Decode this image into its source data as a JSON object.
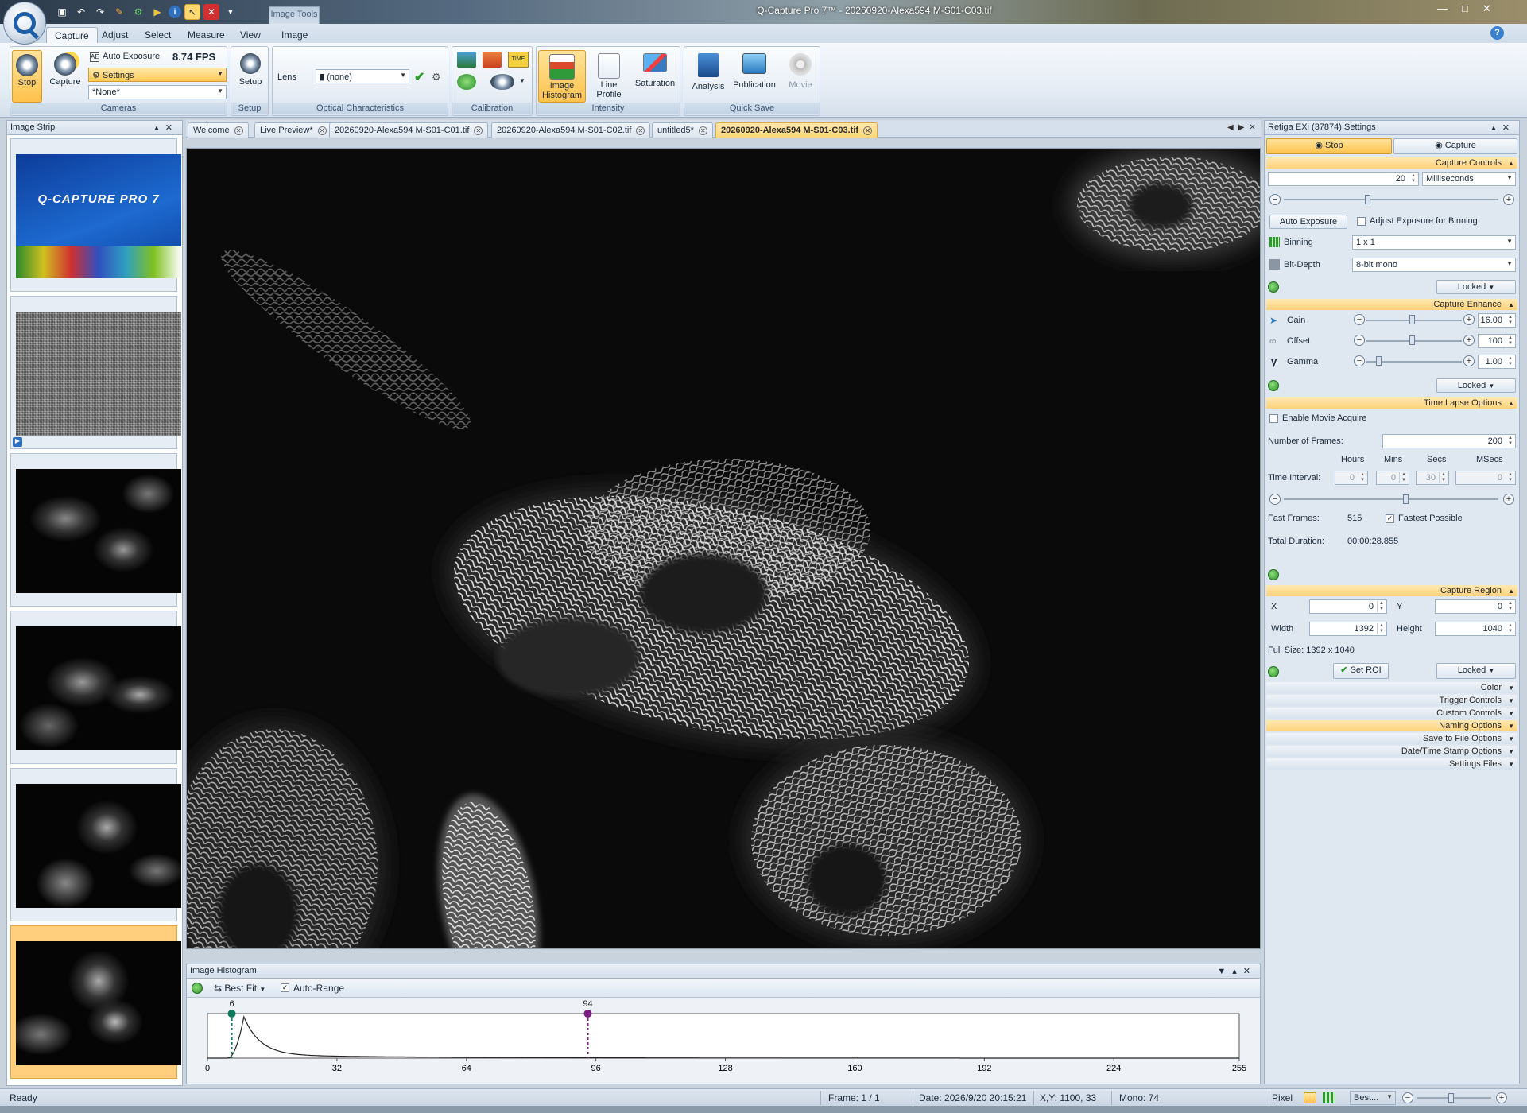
{
  "window": {
    "title": "Q-Capture Pro 7™ - 20260920-Alexa594 M-S01-C03.tif",
    "tool_tab": "Image Tools"
  },
  "ribbon": {
    "tabs": [
      "Capture",
      "Adjust",
      "Select",
      "Measure",
      "View",
      "Image"
    ],
    "stop_label": "Stop",
    "capture_label": "Capture",
    "auto_exposure": "Auto Exposure",
    "fps": "8.74 FPS",
    "settings_label": "Settings",
    "preset": "*None*",
    "group_cameras": "Cameras",
    "setup_label": "Setup",
    "group_setup": "Setup",
    "lens_label": "Lens",
    "lens_value": "(none)",
    "group_optical": "Optical Characteristics",
    "group_calibration": "Calibration",
    "image_histogram": "Image Histogram",
    "line_profile": "Line Profile",
    "saturation": "Saturation",
    "group_intensity": "Intensity",
    "analysis": "Analysis",
    "publication": "Publication",
    "movie": "Movie",
    "group_quicksave": "Quick Save"
  },
  "strip": {
    "title": "Image Strip",
    "splash_title": "Q-CAPTURE PRO 7"
  },
  "doc_tabs": [
    {
      "label": "Welcome"
    },
    {
      "label": "Live Preview*"
    },
    {
      "label": "20260920-Alexa594 M-S01-C01.tif"
    },
    {
      "label": "20260920-Alexa594 M-S01-C02.tif"
    },
    {
      "label": "untitled5*"
    },
    {
      "label": "20260920-Alexa594 M-S01-C03.tif"
    }
  ],
  "histogram": {
    "title": "Image Histogram",
    "fit_label": "Best Fit",
    "auto_range": "Auto-Range",
    "low_marker": "6",
    "high_marker": "94",
    "ticks": [
      "0",
      "32",
      "64",
      "96",
      "128",
      "160",
      "192",
      "224",
      "255"
    ],
    "low_value": 6,
    "high_value": 94,
    "peak_value": 9,
    "max_value": 255
  },
  "settings": {
    "title": "Retiga EXi (37874) Settings",
    "stop": "Stop",
    "capture": "Capture",
    "sec_capture_controls": "Capture Controls",
    "exposure_value": "20",
    "exposure_unit": "Milliseconds",
    "auto_exposure_btn": "Auto Exposure",
    "adjust_binning": "Adjust Exposure for Binning",
    "binning_label": "Binning",
    "binning_value": "1 x 1",
    "bitdepth_label": "Bit-Depth",
    "bitdepth_value": "8-bit mono",
    "locked": "Locked",
    "sec_capture_enhance": "Capture Enhance",
    "gain_label": "Gain",
    "gain_value": "16.00",
    "offset_label": "Offset",
    "offset_value": "100",
    "gamma_label": "Gamma",
    "gamma_value": "1.00",
    "sec_time_lapse": "Time Lapse Options",
    "enable_movie": "Enable Movie Acquire",
    "frames_label": "Number of Frames:",
    "frames_value": "200",
    "hours": "Hours",
    "mins": "Mins",
    "secs": "Secs",
    "msecs": "MSecs",
    "interval_label": "Time Interval:",
    "hours_value": "0",
    "mins_value": "0",
    "secs_value": "30",
    "msecs_value": "0",
    "fast_frames_label": "Fast Frames:",
    "fast_frames_value": "515",
    "fastest": "Fastest Possible",
    "duration_label": "Total Duration:",
    "duration_value": "00:00:28.855",
    "sec_capture_region": "Capture Region",
    "x_label": "X",
    "x_value": "0",
    "y_label": "Y",
    "y_value": "0",
    "width_label": "Width",
    "width_value": "1392",
    "height_label": "Height",
    "height_value": "1040",
    "full_size": "Full Size: 1392 x 1040",
    "set_roi": "Set ROI",
    "collapsed": [
      "Color",
      "Trigger Controls",
      "Custom Controls",
      "Naming Options",
      "Save to File Options",
      "Date/Time Stamp Options",
      "Settings Files"
    ]
  },
  "status": {
    "ready": "Ready",
    "frame": "Frame: 1 / 1",
    "date": "Date: 2026/9/20 20:15:21",
    "xy": "X,Y: 1100,   33",
    "mono": "Mono:   74",
    "pixel": "Pixel",
    "zoom": "Best..."
  },
  "colors": {
    "accent": "#ffd27a",
    "selected_tab": "#ffd77a",
    "low_marker": "#0e7a5c",
    "high_marker": "#7a1a80"
  }
}
